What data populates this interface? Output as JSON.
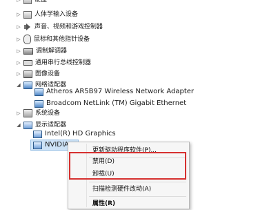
{
  "tree": {
    "top_partial": "硬盘",
    "categories": [
      {
        "label": "人体学输入设备",
        "icon": "hid-device-icon"
      },
      {
        "label": "声音、视频和游戏控制器",
        "icon": "speaker-icon"
      },
      {
        "label": "鼠标和其他指针设备",
        "icon": "mouse-icon"
      },
      {
        "label": "调制解调器",
        "icon": "modem-icon"
      },
      {
        "label": "通用串行总线控制器",
        "icon": "usb-port-icon"
      },
      {
        "label": "图像设备",
        "icon": "imaging-device-icon"
      },
      {
        "label": "网络适配器",
        "icon": "network-adapter-icon"
      }
    ],
    "network_children": [
      "Atheros AR5B97 Wireless Network Adapter",
      "Broadcom NetLink (TM) Gigabit Ethernet"
    ],
    "system_devices": "系统设备",
    "display_adapters": "显示适配器",
    "display_children": [
      "Intel(R) HD Graphics",
      "NVIDIA G"
    ]
  },
  "context_menu": {
    "update_driver": "更新驱动程序软件(P)...",
    "disable": "禁用(D)",
    "uninstall": "卸载(U)",
    "scan_hardware": "扫描检测硬件改动(A)",
    "properties": "属性(R)"
  },
  "colors": {
    "highlight_border": "#d6302f",
    "selection": "#cde3f7"
  }
}
